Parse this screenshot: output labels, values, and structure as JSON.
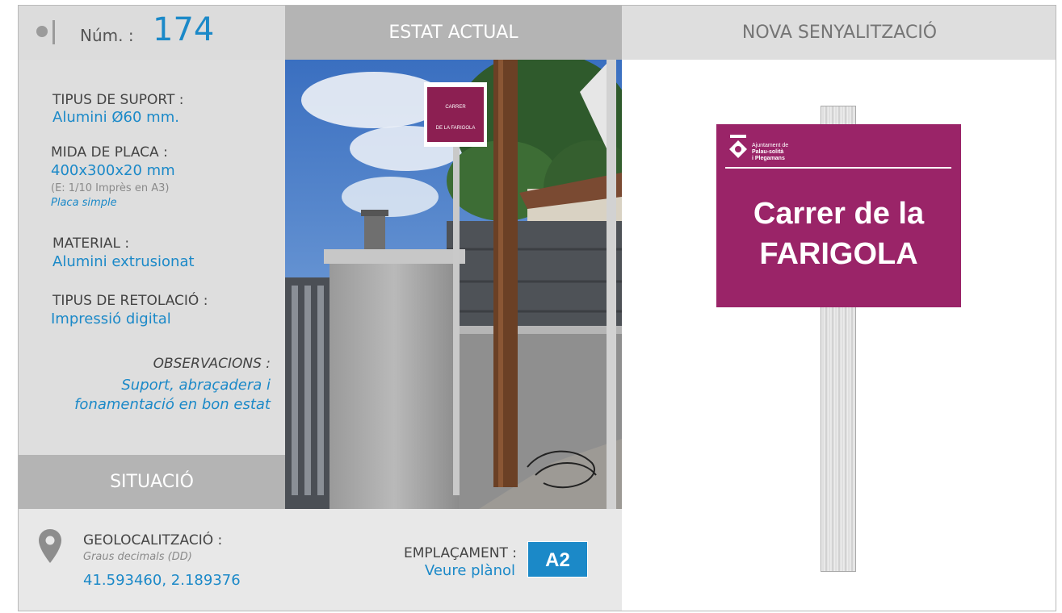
{
  "header": {
    "num_label": "Núm. :",
    "num_value": "174",
    "estat_actual": "ESTAT ACTUAL",
    "nova_senyalitzacio": "NOVA SENYALITZACIÓ"
  },
  "info": {
    "tipus_suport_label": "TIPUS DE SUPORT :",
    "tipus_suport_value": "Alumini Ø60 mm.",
    "mida_placa_label": "MIDA DE PLACA :",
    "mida_placa_value": "400x300x20 mm",
    "mida_placa_scale": "(E: 1/10 Imprès en A3)",
    "mida_placa_type": "Placa simple",
    "material_label": "MATERIAL :",
    "material_value": "Alumini extrusionat",
    "retolacio_label": "TIPUS DE RETOLACIÓ :",
    "retolacio_value": "Impressió digital",
    "observacions_label": "OBSERVACIONS :",
    "observacions_lines": [
      "Suport, abraçadera i",
      "fonamentació en bon estat"
    ]
  },
  "situacio": {
    "title": "SITUACIÓ",
    "geo_label": "GEOLOCALITZACIÓ :",
    "geo_format": "Graus decimals (DD)",
    "geo_value": "41.593460, 2.189376",
    "emplacament_label": "EMPLAÇAMENT :",
    "emplacament_link": "Veure plànol",
    "emplacament_code": "A2"
  },
  "photo_sign": {
    "line1": "CARRER",
    "line2": "DE LA FARIGOLA"
  },
  "new_sign": {
    "logo_lines": [
      "Ajuntament de",
      "Palau-solità",
      "i Plegamans"
    ],
    "line1": "Carrer de la",
    "line2": "FARIGOLA",
    "plate_color": "#9a2468"
  },
  "colors": {
    "accent": "#1b89c8",
    "header_dark": "#b4b4b4",
    "panel": "#dedede"
  }
}
